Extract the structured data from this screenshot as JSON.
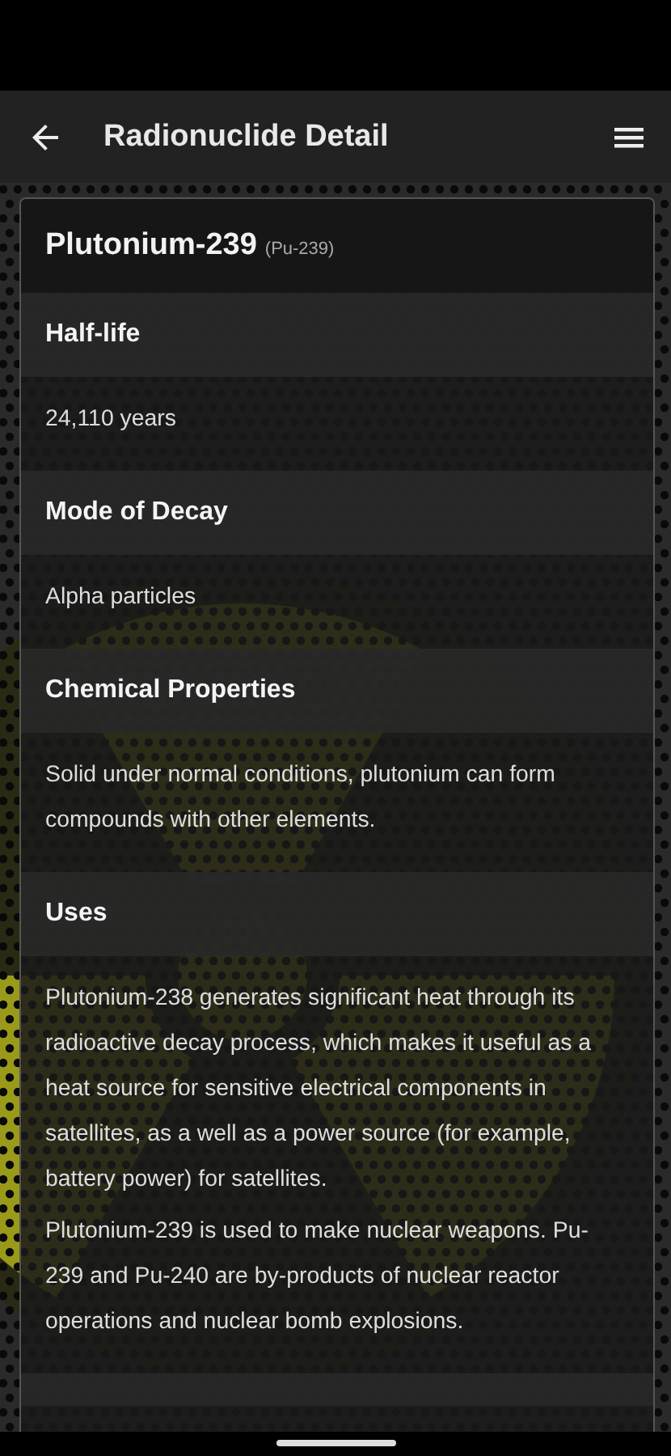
{
  "app_bar": {
    "title": "Radionuclide Detail"
  },
  "nuclide": {
    "name": "Plutonium-239",
    "symbol": "(Pu-239)"
  },
  "sections": [
    {
      "title": "Half-life",
      "paragraphs": [
        "24,110 years"
      ]
    },
    {
      "title": "Mode of Decay",
      "paragraphs": [
        "Alpha particles"
      ]
    },
    {
      "title": "Chemical Properties",
      "paragraphs": [
        "Solid under normal conditions, plutonium can form compounds with other elements."
      ]
    },
    {
      "title": "Uses",
      "paragraphs": [
        "Plutonium-238 generates significant heat through its radioactive decay process, which makes it useful as a heat source for sensitive electrical components in satellites, as a well as a power source (for example, battery power) for satellites.",
        "Plutonium-239 is used to make nuclear weapons. Pu-239 and Pu-240 are by-products of nuclear reactor operations and nuclear bomb explosions."
      ]
    }
  ]
}
